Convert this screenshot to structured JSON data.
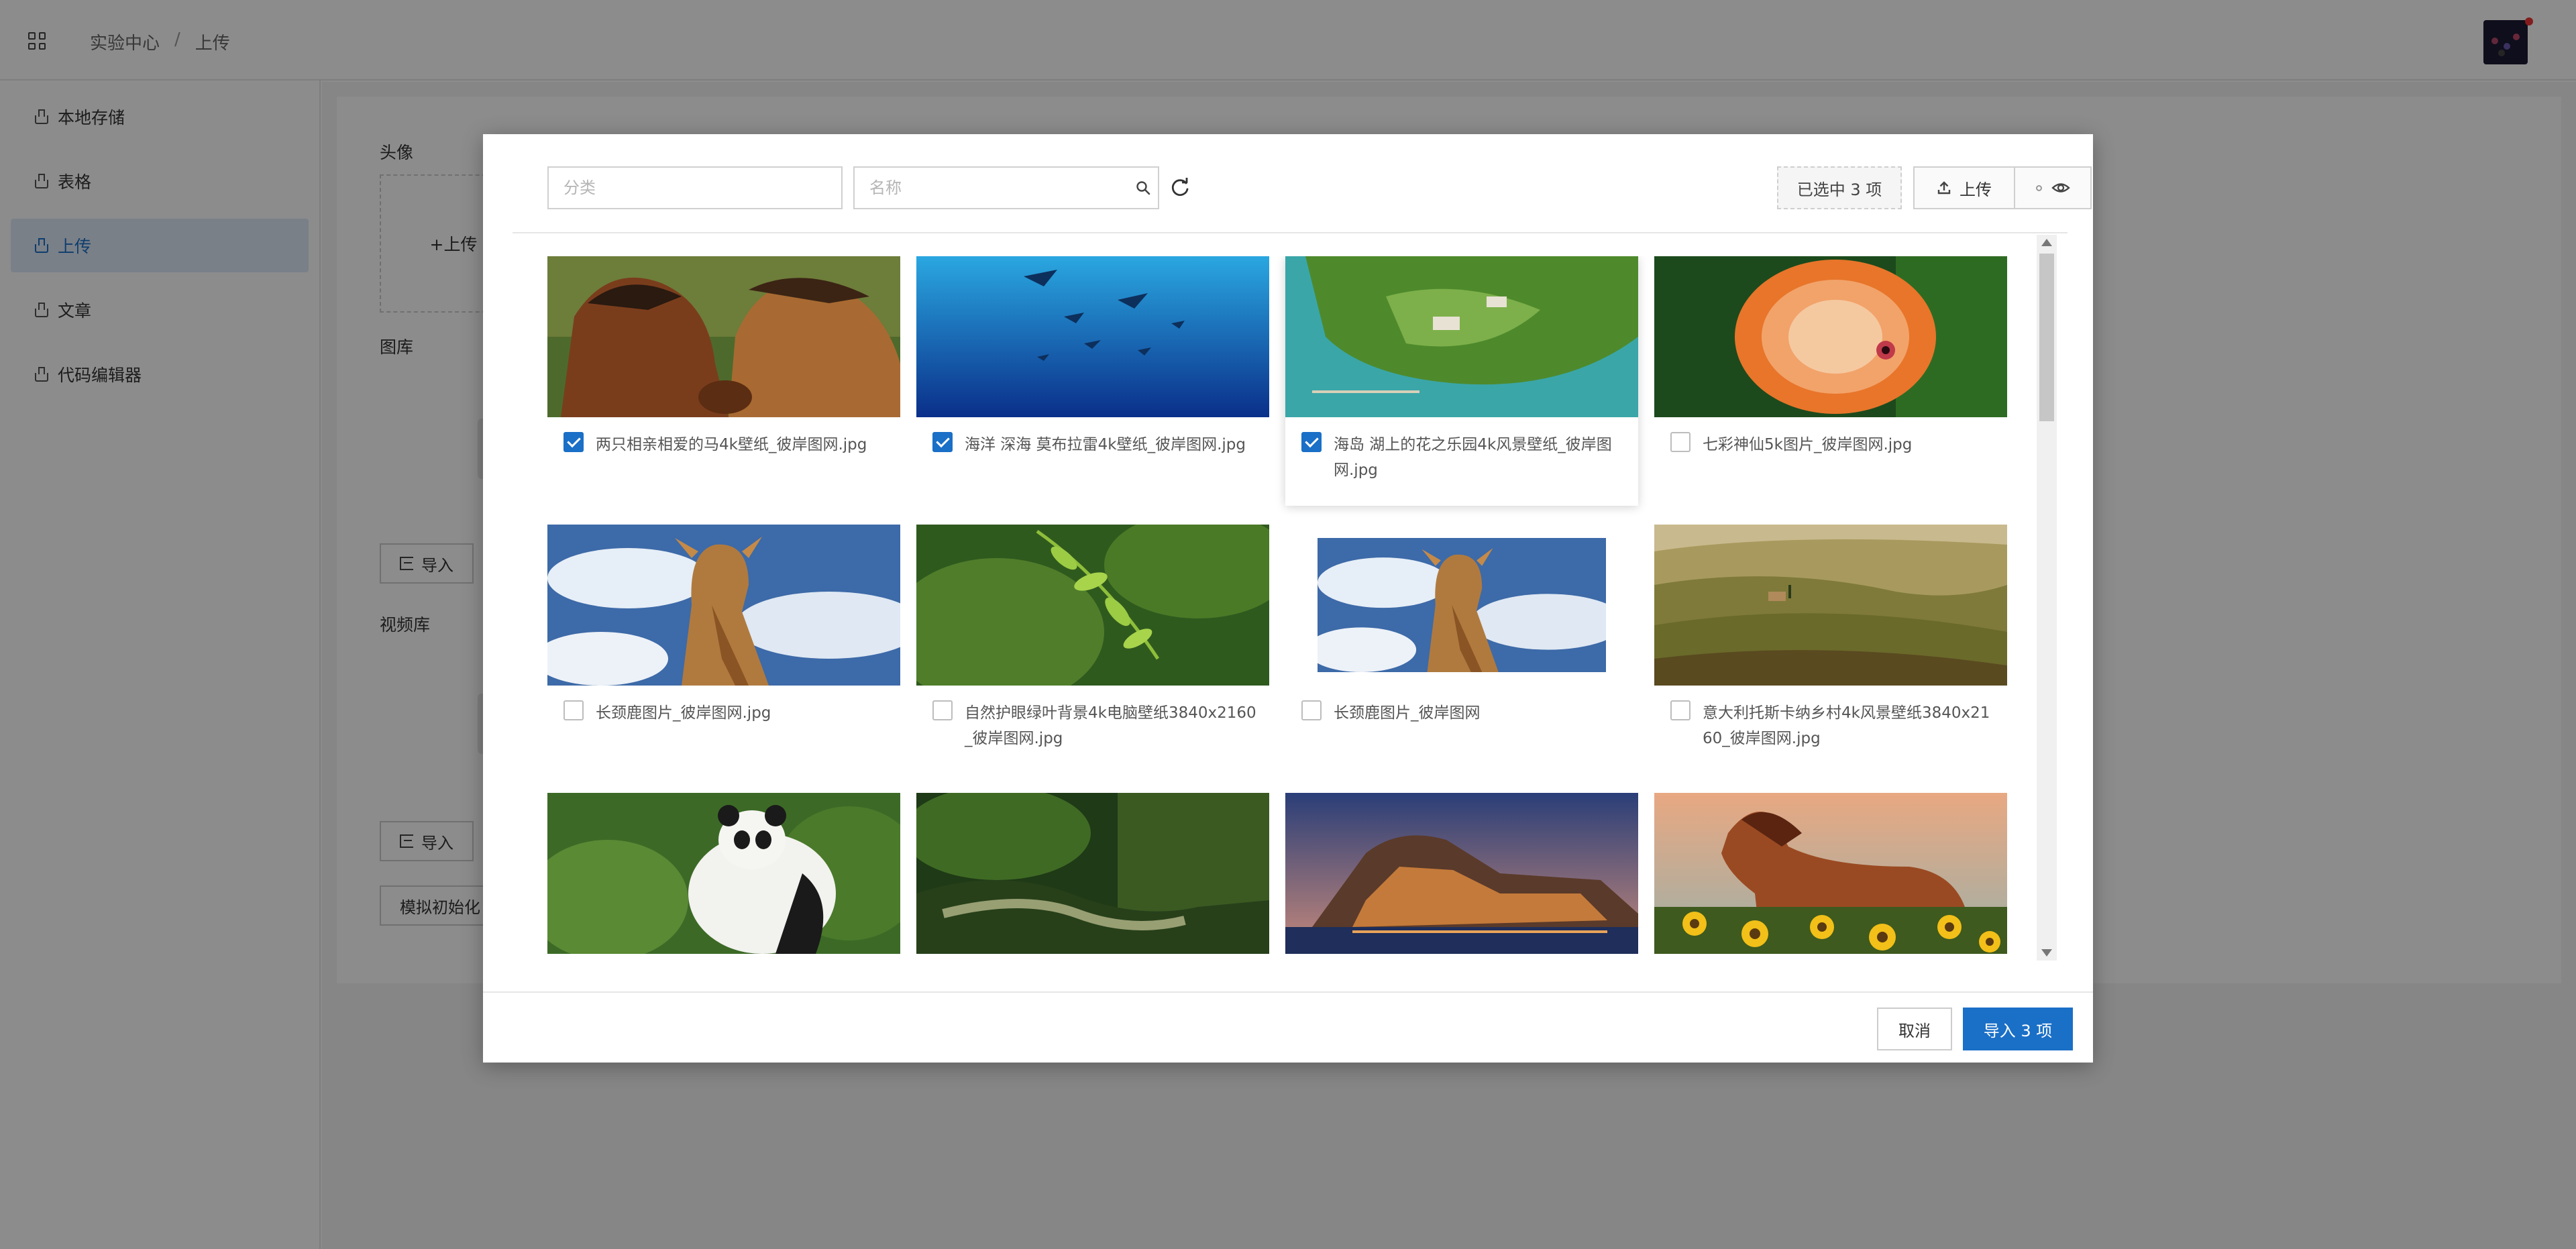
{
  "breadcrumb": {
    "root": "实验中心",
    "separator": "/",
    "current": "上传"
  },
  "sidebar": {
    "items": [
      {
        "label": "本地存储"
      },
      {
        "label": "表格"
      },
      {
        "label": "上传"
      },
      {
        "label": "文章"
      },
      {
        "label": "代码编辑器"
      }
    ]
  },
  "main": {
    "avatar_label": "头像",
    "upload_label": "+上传",
    "gallery_label": "图库",
    "import_label": "导入",
    "video_label": "视频库",
    "import_label_2": "导入",
    "simulate_label": "模拟初始化"
  },
  "modal": {
    "category_placeholder": "分类",
    "name_placeholder": "名称",
    "selected_label": "已选中 3 项",
    "upload_label": "上传",
    "cancel_label": "取消",
    "import_label": "导入 3 项",
    "accent_color": "#1a6fc7",
    "images": [
      {
        "name": "两只相亲相爱的马4k壁纸_彼岸图网.jpg",
        "checked": true,
        "icon": "horses-photo"
      },
      {
        "name": "海洋 深海 莫布拉雷4k壁纸_彼岸图网.jpg",
        "checked": true,
        "icon": "ocean-rays-photo"
      },
      {
        "name": "海岛 湖上的花之乐园4k风景壁纸_彼岸图网.jpg",
        "checked": true,
        "icon": "island-photo"
      },
      {
        "name": "七彩神仙5k图片_彼岸图网.jpg",
        "checked": false,
        "icon": "discus-fish-photo"
      },
      {
        "name": "长颈鹿图片_彼岸图网.jpg",
        "checked": false,
        "icon": "giraffe-photo"
      },
      {
        "name": "自然护眼绿叶背景4k电脑壁纸3840x2160_彼岸图网.jpg",
        "checked": false,
        "icon": "green-leaves-photo"
      },
      {
        "name": "长颈鹿图片_彼岸图网",
        "checked": false,
        "icon": "giraffe-photo"
      },
      {
        "name": "意大利托斯卡纳乡村4k风景壁纸3840x2160_彼岸图网.jpg",
        "checked": false,
        "icon": "tuscany-photo"
      },
      {
        "name": "",
        "checked": false,
        "icon": "panda-photo"
      },
      {
        "name": "",
        "checked": false,
        "icon": "forest-stream-photo"
      },
      {
        "name": "",
        "checked": false,
        "icon": "coastal-town-photo"
      },
      {
        "name": "",
        "checked": false,
        "icon": "horse-sunflowers-photo"
      }
    ]
  }
}
